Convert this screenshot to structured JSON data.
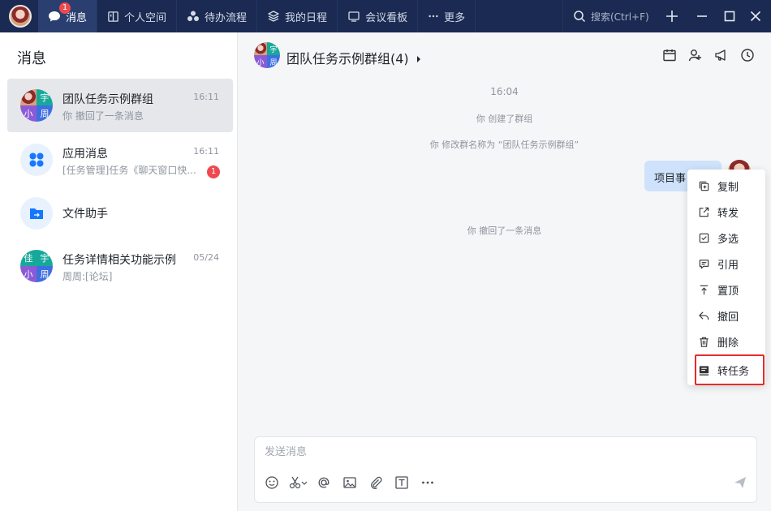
{
  "topbar": {
    "tabs": [
      {
        "label": "消息",
        "badge": "1"
      },
      {
        "label": "个人空间"
      },
      {
        "label": "待办流程"
      },
      {
        "label": "我的日程"
      },
      {
        "label": "会议看板"
      },
      {
        "label": "更多"
      }
    ],
    "search_placeholder": "搜索(Ctrl+F)"
  },
  "sidebar": {
    "title": "消息",
    "conversations": [
      {
        "name": "团队任务示例群组",
        "time": "16:11",
        "preview": "你 撤回了一条消息",
        "avatar_chars": [
          "",
          "宇",
          "小",
          "周"
        ]
      },
      {
        "name": "应用消息",
        "time": "16:11",
        "preview": "[任务管理]任务《聊天窗口快...",
        "badge": "1"
      },
      {
        "name": "文件助手"
      },
      {
        "name": "任务详情相关功能示例",
        "time": "05/24",
        "preview": "周周:[论坛]",
        "avatar_chars": [
          "佳",
          "宇",
          "小",
          "周"
        ]
      }
    ]
  },
  "chat": {
    "title": "团队任务示例群组(4)",
    "header_avatar_chars": [
      "",
      "宇",
      "小",
      "周"
    ],
    "messages": {
      "time": "16:04",
      "sys1": "你 创建了群组",
      "sys2": "你 修改群名称为 “团队任务示例群组”",
      "bubble": "项目事",
      "sys3": "你 撤回了一条消息"
    },
    "composer_placeholder": "发送消息"
  },
  "context_menu": {
    "items": [
      "复制",
      "转发",
      "多选",
      "引用",
      "置顶",
      "撤回",
      "删除",
      "转任务"
    ]
  },
  "colors": {
    "topbar": "#1a2a52",
    "accent_blue": "#1677ff",
    "badge_red": "#f0484f",
    "highlight_red": "#e82a2a",
    "bubble": "#cfe2fb"
  }
}
